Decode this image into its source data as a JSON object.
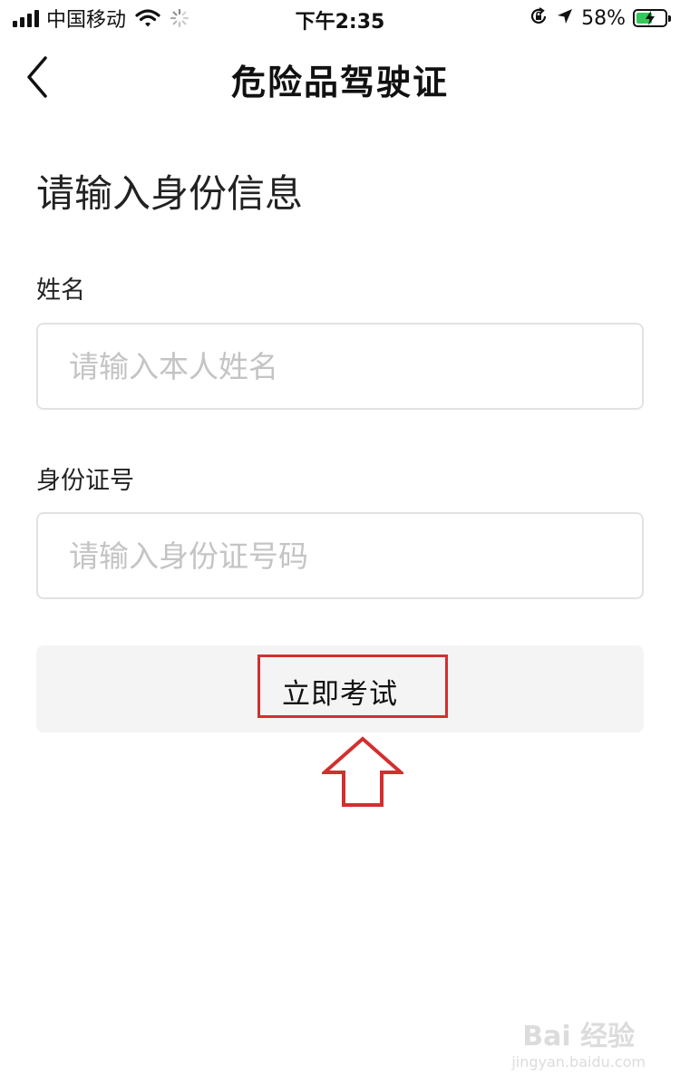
{
  "status_bar": {
    "carrier": "中国移动",
    "time": "下午2:35",
    "battery_percent": "58%",
    "battery_level": 0.58,
    "icons": [
      "signal-icon",
      "wifi-icon",
      "loading-icon",
      "rotation-lock-icon",
      "location-icon",
      "battery-icon"
    ]
  },
  "nav": {
    "title": "危险品驾驶证",
    "back_icon": "chevron-left-icon"
  },
  "form": {
    "heading": "请输入身份信息",
    "name_label": "姓名",
    "name_placeholder": "请输入本人姓名",
    "name_value": "",
    "id_label": "身份证号",
    "id_placeholder": "请输入身份证号码",
    "id_value": "",
    "submit_label": "立即考试"
  },
  "annotation": {
    "highlight_color": "#d32f2f",
    "arrow_icon": "arrow-up-icon"
  },
  "watermark": {
    "main": "Bai 经验",
    "sub": "jingyan.baidu.com"
  }
}
